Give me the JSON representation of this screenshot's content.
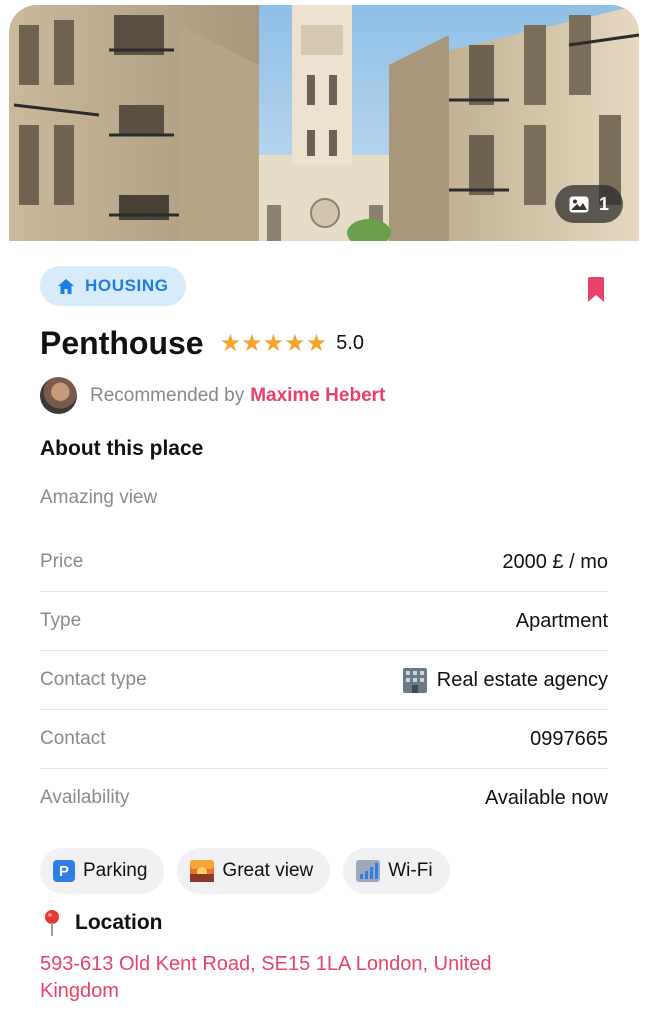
{
  "hero": {
    "photo_count": "1",
    "photo_icon": "image-icon"
  },
  "category": {
    "label": "HOUSING",
    "icon": "home-icon",
    "color": "#1e7fe0"
  },
  "bookmark_icon": "bookmark-icon",
  "listing": {
    "title": "Penthouse",
    "rating_stars": 5,
    "rating": "5.0"
  },
  "recommendation": {
    "prefix": "Recommended by",
    "name": "Maxime Hebert"
  },
  "about": {
    "heading": "About this place",
    "description": "Amazing view"
  },
  "details": [
    {
      "key": "Price",
      "value": "2000 £ / mo"
    },
    {
      "key": "Type",
      "value": "Apartment"
    },
    {
      "key": "Contact type",
      "value": "Real estate agency",
      "icon": "building-icon"
    },
    {
      "key": "Contact",
      "value": "0997665"
    },
    {
      "key": "Availability",
      "value": "Available now"
    }
  ],
  "amenities": [
    {
      "label": "Parking",
      "icon": "parking-icon"
    },
    {
      "label": "Great view",
      "icon": "sunset-icon"
    },
    {
      "label": "Wi-Fi",
      "icon": "signal-icon"
    }
  ],
  "location": {
    "heading": "Location",
    "icon": "pin-icon",
    "address": "593-613 Old Kent Road, SE15 1LA London, United Kingdom"
  },
  "colors": {
    "accent_pink": "#e8426a",
    "star": "#f4a42a",
    "chip_bg": "#d8ebfb"
  }
}
